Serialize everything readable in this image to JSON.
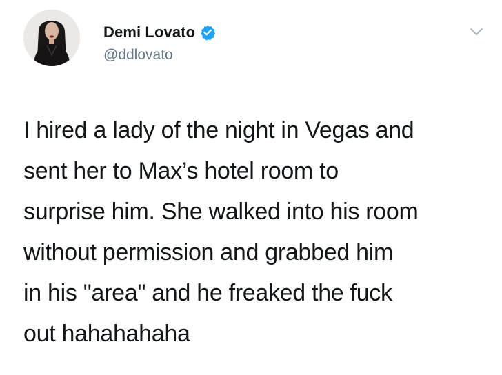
{
  "user": {
    "display_name": "Demi Lovato",
    "handle": "@ddlovato",
    "verified": true,
    "avatar_icon": "profile-photo",
    "verified_icon": "verified-badge-icon",
    "menu_icon": "chevron-down-icon"
  },
  "tweet": {
    "lines": [
      "I hired a lady of the night in Vegas and",
      "sent her to Max’s hotel room to",
      "surprise him. She walked into his room",
      "without permission and grabbed him",
      "in his \"area\" and he freaked the fuck",
      "out hahahahaha"
    ]
  },
  "colors": {
    "text": "#14171a",
    "secondary": "#657786",
    "verified_blue": "#1da1f2",
    "background": "#ffffff"
  }
}
